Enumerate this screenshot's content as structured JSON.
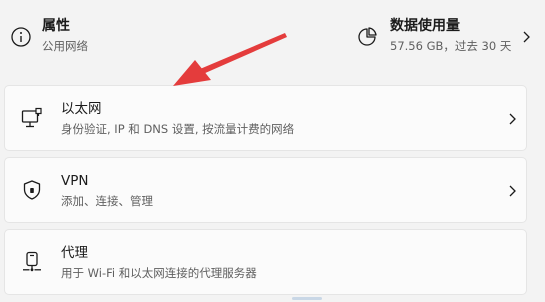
{
  "summary": {
    "properties": {
      "title": "属性",
      "subtitle": "公用网络",
      "icon": "info-icon"
    },
    "data_usage": {
      "title": "数据使用量",
      "subtitle": "57.56 GB，过去 30 天",
      "icon": "pie-chart-icon"
    }
  },
  "cards": {
    "ethernet": {
      "title": "以太网",
      "subtitle": "身份验证, IP 和 DNS 设置, 按流量计费的网络",
      "icon": "ethernet-icon"
    },
    "vpn": {
      "title": "VPN",
      "subtitle": "添加、连接、管理",
      "icon": "shield-icon"
    },
    "proxy": {
      "title": "代理",
      "subtitle": "用于 Wi-Fi 和以太网连接的代理服务器",
      "icon": "proxy-server-icon"
    }
  },
  "colors": {
    "annotation": "#e43c3c",
    "card_bg": "#fbfbfb",
    "page_bg": "#f3f3f3"
  }
}
